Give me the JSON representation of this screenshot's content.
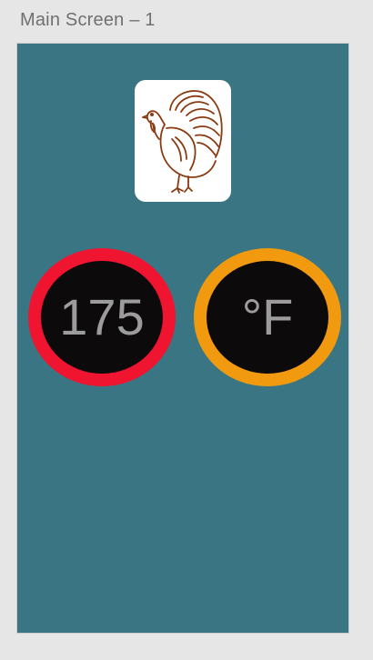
{
  "artboard": {
    "label": "Main Screen – 1",
    "background": "#3a7583"
  },
  "logo": {
    "icon": "turkey-icon"
  },
  "temperature_dial": {
    "value": "175",
    "ring_color": "#ef1530"
  },
  "unit_dial": {
    "value": "°F",
    "ring_color": "#f29a0f"
  }
}
